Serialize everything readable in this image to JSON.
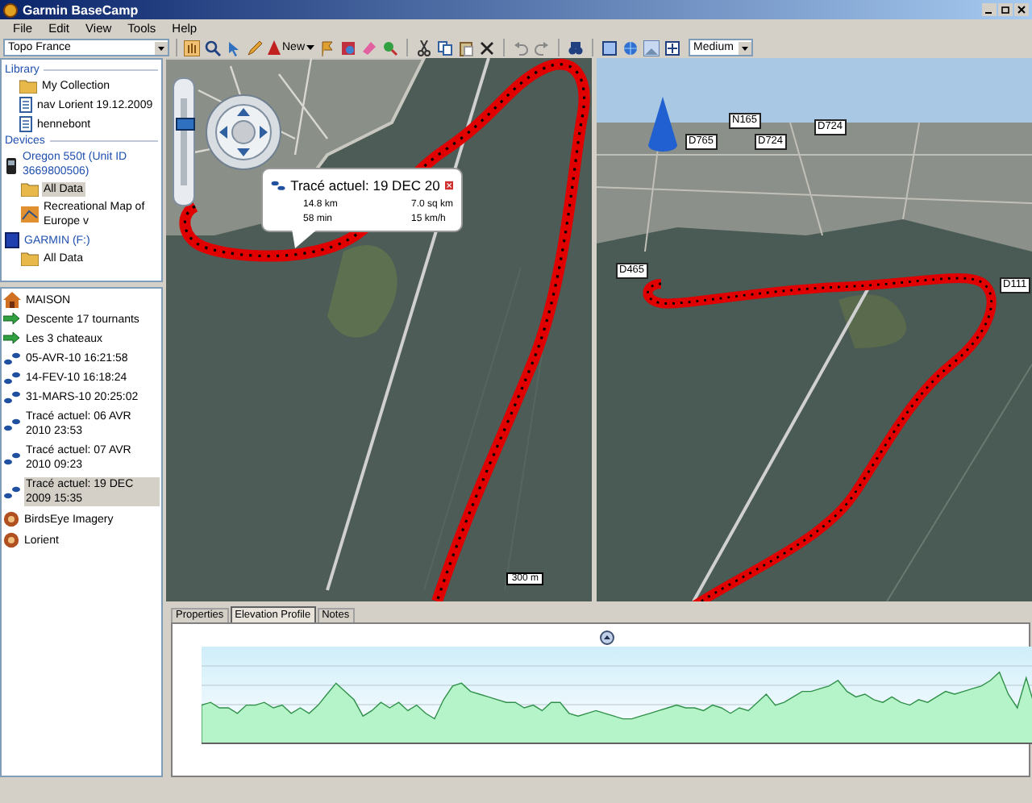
{
  "window": {
    "title": "Garmin BaseCamp"
  },
  "menu": [
    "File",
    "Edit",
    "View",
    "Tools",
    "Help"
  ],
  "toolbar": {
    "map_product": "Topo France",
    "new_label": "New",
    "detail_level": "Medium"
  },
  "library": {
    "heading": "Library",
    "items": [
      {
        "label": "My Collection",
        "kind": "folder",
        "selected": false
      },
      {
        "label": "nav Lorient 19.12.2009",
        "kind": "list",
        "selected": false
      },
      {
        "label": "hennebont",
        "kind": "list",
        "selected": false
      }
    ]
  },
  "devices": {
    "heading": "Devices",
    "items": [
      {
        "label": "Oregon 550t (Unit ID 3669800506)",
        "kind": "device",
        "selected": false,
        "children": [
          {
            "label": "All Data",
            "kind": "folder",
            "selected": true
          },
          {
            "label": "Recreational Map of Europe v",
            "kind": "map",
            "selected": false
          }
        ]
      },
      {
        "label": "GARMIN (F:)",
        "kind": "card",
        "selected": false,
        "children": [
          {
            "label": "All Data",
            "kind": "folder",
            "selected": false
          }
        ]
      }
    ]
  },
  "items": [
    {
      "label": "MAISON",
      "kind": "waypoint",
      "selected": false
    },
    {
      "label": "Descente 17 tournants",
      "kind": "route",
      "selected": false
    },
    {
      "label": "Les 3 chateaux",
      "kind": "route",
      "selected": false
    },
    {
      "label": "05-AVR-10 16:21:58",
      "kind": "track",
      "selected": false
    },
    {
      "label": "14-FEV-10 16:18:24",
      "kind": "track",
      "selected": false
    },
    {
      "label": "31-MARS-10 20:25:02",
      "kind": "track",
      "selected": false
    },
    {
      "label": "Tracé actuel: 06 AVR 2010 23:53",
      "kind": "track",
      "selected": false
    },
    {
      "label": "Tracé actuel: 07 AVR 2010 09:23",
      "kind": "track",
      "selected": false
    },
    {
      "label": "Tracé actuel: 19 DEC 2009 15:35",
      "kind": "track",
      "selected": true
    },
    {
      "label": "BirdsEye Imagery",
      "kind": "imagery",
      "selected": false
    },
    {
      "label": "Lorient",
      "kind": "imagery",
      "selected": false
    }
  ],
  "zoom": {
    "level": 0.75
  },
  "popup": {
    "title": "Tracé actuel: 19 DEC 20",
    "distance": "14.8 km",
    "area": "7.0 sq km",
    "time": "58 min",
    "speed": "15 km/h"
  },
  "maps": [
    {
      "kind": "flat",
      "scale": "300 m"
    },
    {
      "kind": "perspective",
      "roads": [
        "N165",
        "D765",
        "D724",
        "D724",
        "D465",
        "D111"
      ]
    }
  ],
  "bottom": {
    "tabs": [
      {
        "label": "Properties",
        "selected": false
      },
      {
        "label": "Elevation Profile",
        "selected": true
      },
      {
        "label": "Notes",
        "selected": false
      }
    ]
  }
}
